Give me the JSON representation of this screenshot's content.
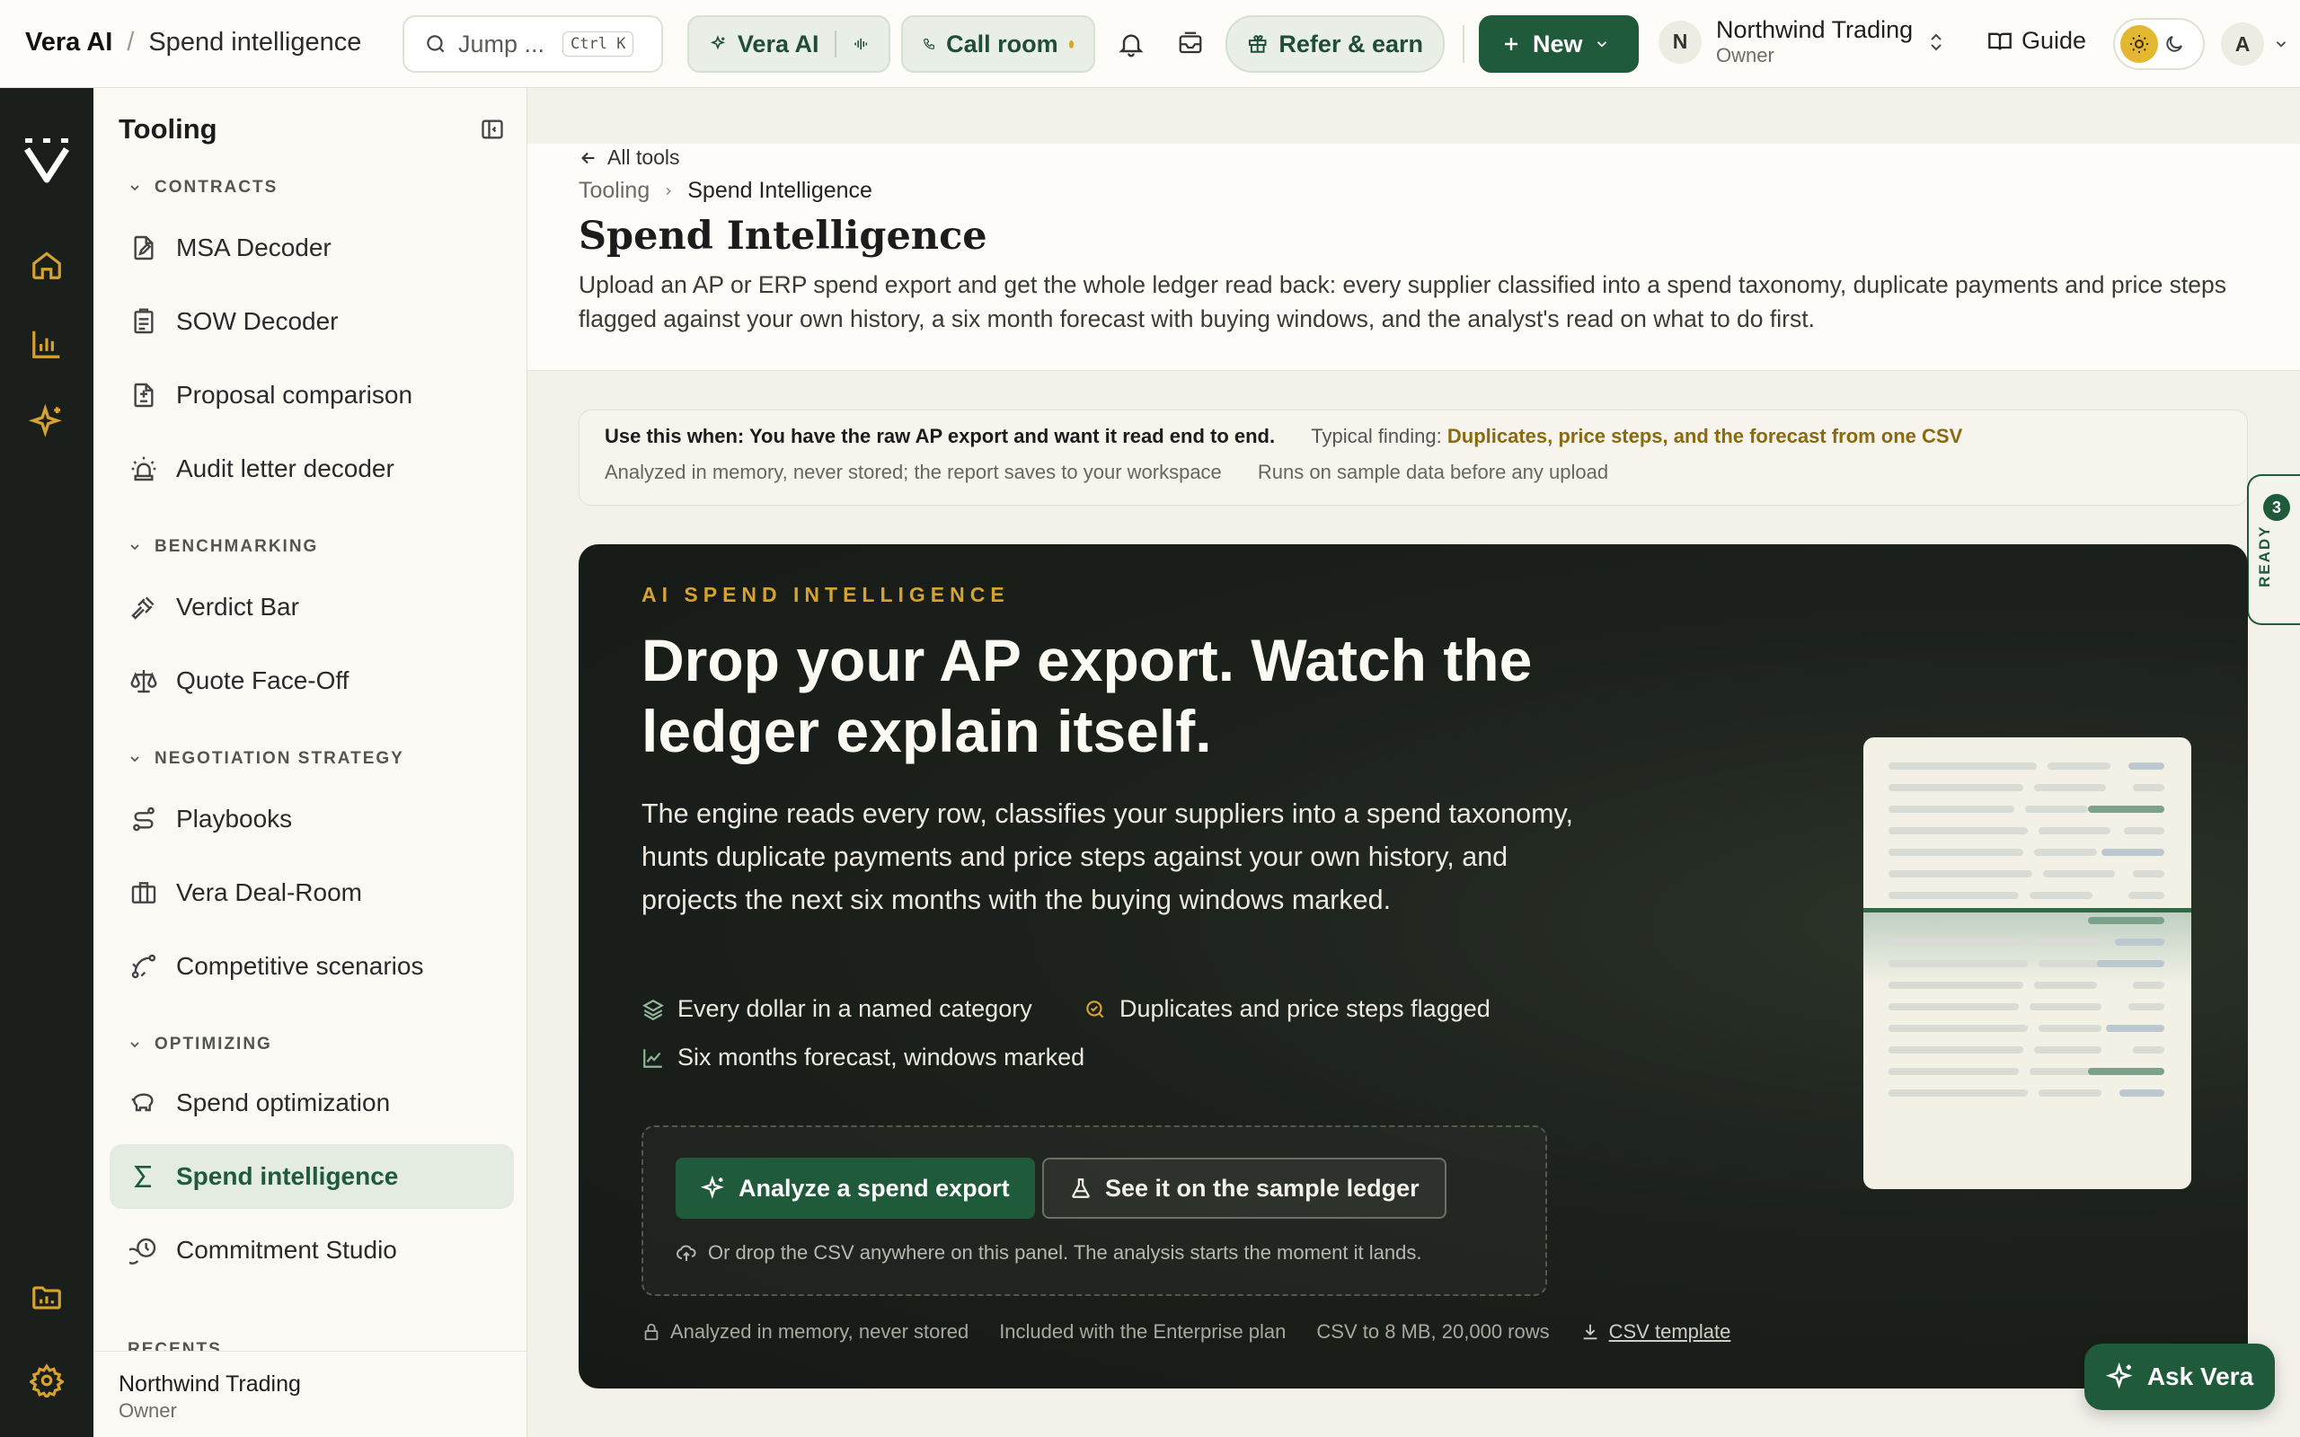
{
  "topbar": {
    "app_name": "Vera AI",
    "separator": "/",
    "page_name": "Spend intelligence",
    "search_placeholder": "Jump ...",
    "search_shortcut": "Ctrl K",
    "vera_label": "Vera AI",
    "call_label": "Call room",
    "refer_label": "Refer & earn",
    "new_label": "New",
    "org_initial": "N",
    "org_name": "Northwind Trading",
    "org_role": "Owner",
    "guide_label": "Guide",
    "user_initial": "A"
  },
  "sidebar": {
    "title": "Tooling",
    "sections": [
      {
        "label": "CONTRACTS",
        "items": [
          "MSA Decoder",
          "SOW Decoder",
          "Proposal comparison",
          "Audit letter decoder"
        ]
      },
      {
        "label": "BENCHMARKING",
        "items": [
          "Verdict Bar",
          "Quote Face-Off"
        ]
      },
      {
        "label": "NEGOTIATION STRATEGY",
        "items": [
          "Playbooks",
          "Vera Deal-Room",
          "Competitive scenarios"
        ]
      },
      {
        "label": "OPTIMIZING",
        "items": [
          "Spend optimization",
          "Spend intelligence",
          "Commitment Studio"
        ]
      }
    ],
    "active_item": "Spend intelligence",
    "recents_label": "RECENTS",
    "footer_name": "Northwind Trading",
    "footer_role": "Owner"
  },
  "page": {
    "back_label": "All tools",
    "breadcrumb_root": "Tooling",
    "breadcrumb_current": "Spend Intelligence",
    "title": "Spend Intelligence",
    "description": "Upload an AP or ERP spend export and get the whole ledger read back: every supplier classified into a spend taxonomy, duplicate payments and price steps flagged against your own history, a six month forecast with buying windows, and the analyst's read on what to do first."
  },
  "usecase": {
    "when_label": "Use this when: You have the raw AP export and want it read end to end.",
    "typical_label": "Typical finding:",
    "typical_value": "Duplicates, price steps, and the forecast from one CSV",
    "note_storage": "Analyzed in memory, never stored; the report saves to your workspace",
    "note_sample": "Runs on sample data before any upload"
  },
  "ready_tab": {
    "count": "3",
    "label": "READY"
  },
  "hero": {
    "eyebrow": "AI SPEND INTELLIGENCE",
    "headline": "Drop your AP export. Watch the ledger explain itself.",
    "lead": "The engine reads every row, classifies your suppliers into a spend taxonomy, hunts duplicate payments and price steps against your own history, and projects the next six months with the buying windows marked.",
    "features": [
      "Every dollar in a named category",
      "Duplicates and price steps flagged",
      "Six months forecast, windows marked"
    ],
    "primary_cta": "Analyze a spend export",
    "secondary_cta": "See it on the sample ledger",
    "drop_hint": "Or drop the CSV anywhere on this panel. The analysis starts the moment it lands.",
    "footer": [
      "Analyzed in memory, never stored",
      "Included with the Enterprise plan",
      "CSV to 8 MB, 20,000 rows"
    ],
    "template_link": "CSV template"
  },
  "ask_vera": "Ask Vera",
  "colors": {
    "brand_green": "#1f5a3a",
    "accent_gold": "#d6a230",
    "rail_dark": "#1b1f1b"
  }
}
